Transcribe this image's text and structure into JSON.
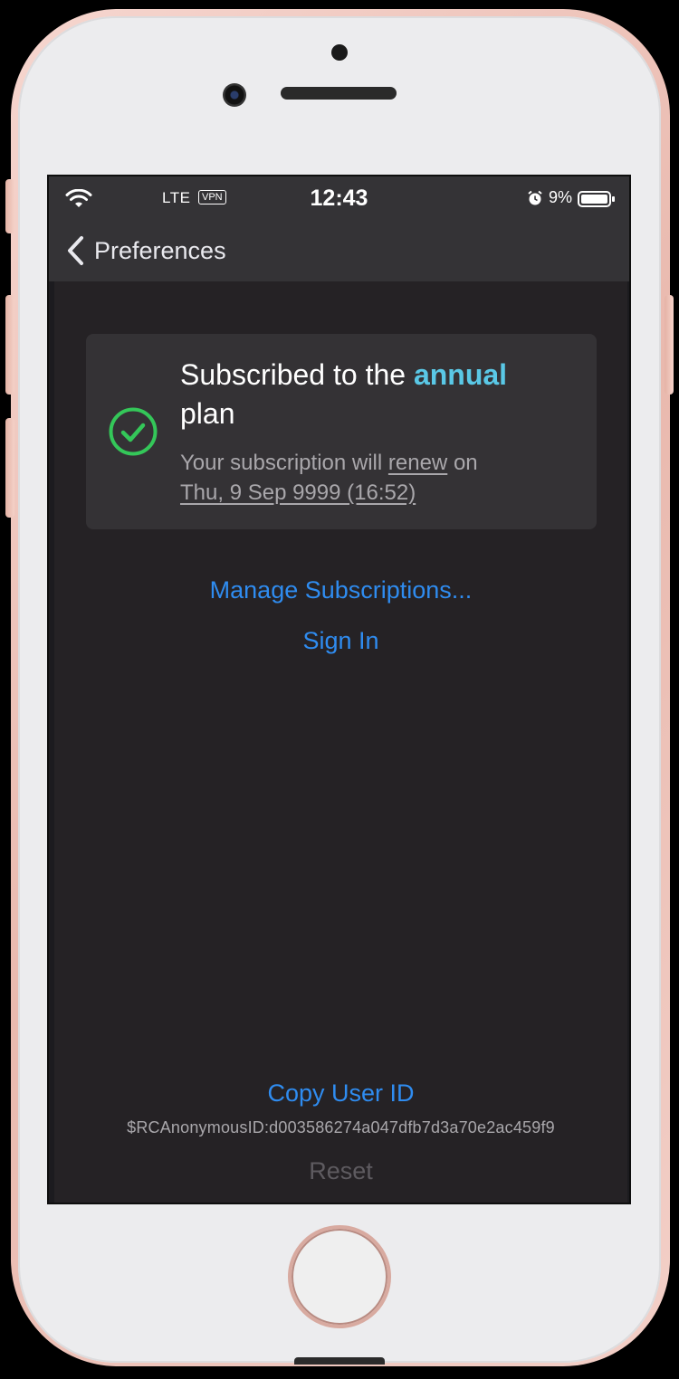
{
  "status_bar": {
    "carrier": "LTE",
    "vpn": "VPN",
    "time": "12:43",
    "battery": "9%"
  },
  "nav": {
    "back_label": "Preferences"
  },
  "subscription": {
    "title_prefix": "Subscribed to the",
    "plan_name": "annual",
    "title_suffix": "plan",
    "detail_prefix": "Your subscription will",
    "detail_action": "renew",
    "detail_on": "on",
    "renew_date": "Thu, 9 Sep 9999 (16:52)"
  },
  "actions": {
    "manage": "Manage Subscriptions...",
    "sign_in": "Sign In",
    "copy_user_id": "Copy User ID",
    "user_id": "$RCAnonymousID:d003586274a047dfb7d3a70e2ac459f9",
    "reset": "Reset"
  },
  "colors": {
    "accent_link": "#2f8cf0",
    "plan_highlight": "#5ac8e6",
    "success_green": "#34c759"
  },
  "icons": [
    "wifi-icon",
    "alarm-icon",
    "battery-icon",
    "chevron-left-icon",
    "checkmark-circle-icon"
  ]
}
